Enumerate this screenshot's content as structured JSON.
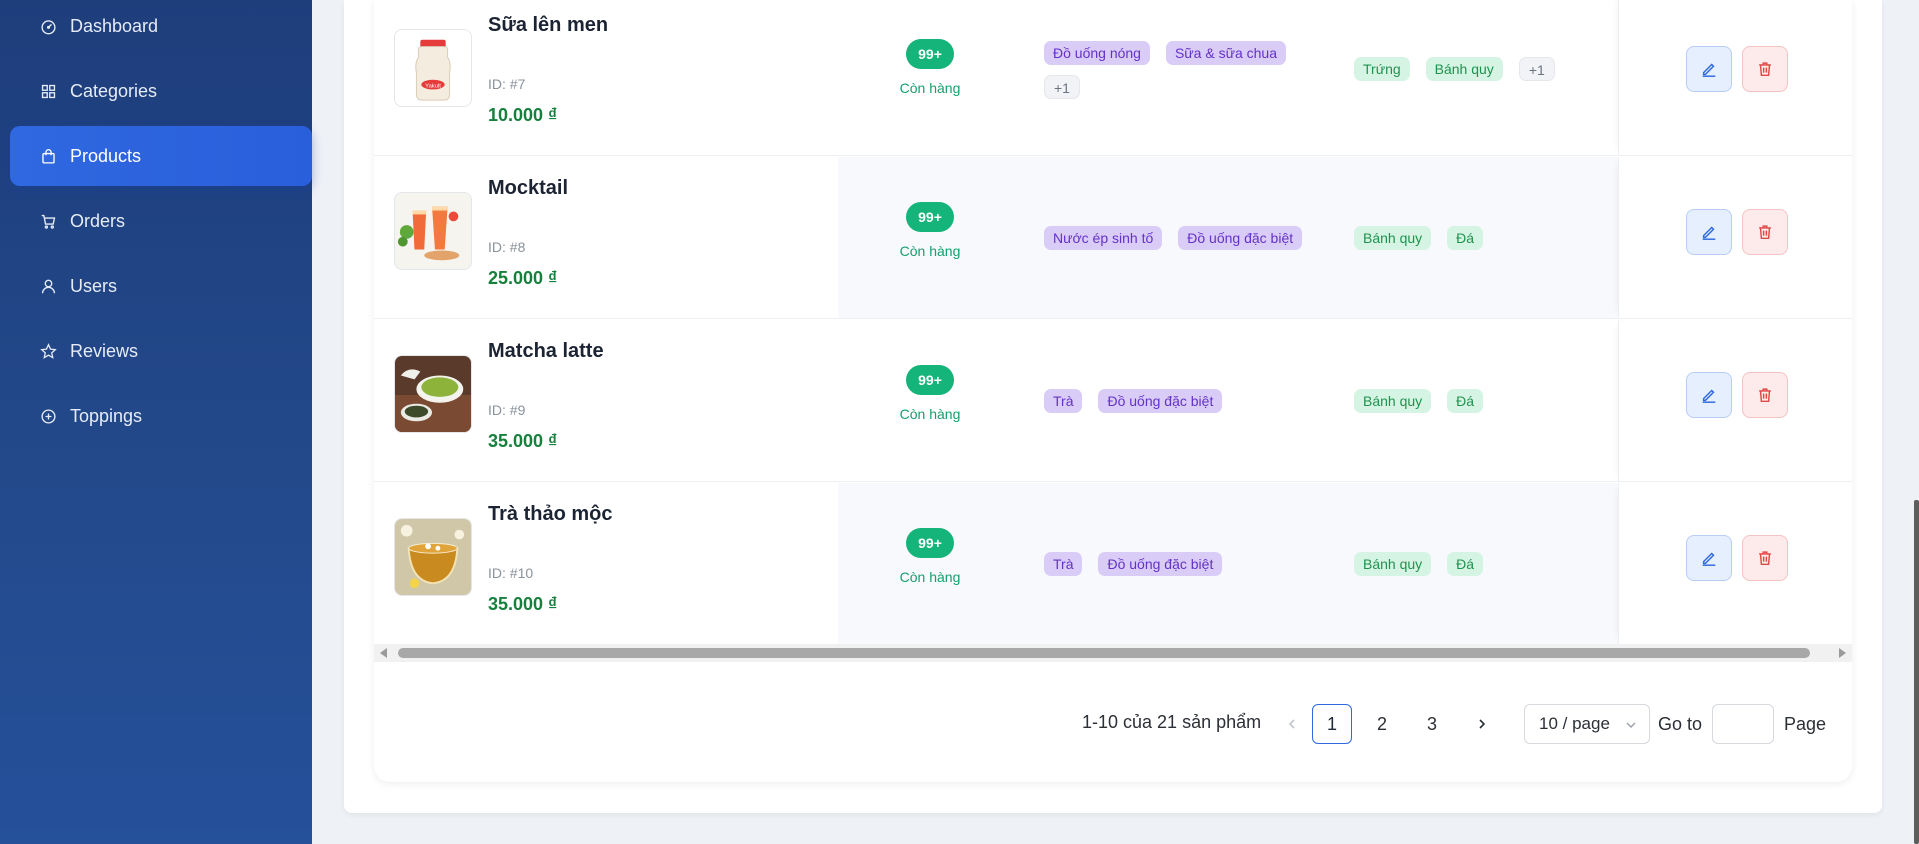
{
  "sidebar": {
    "items": [
      {
        "label": "Dashboard",
        "icon": "dashboard-icon",
        "active": false
      },
      {
        "label": "Categories",
        "icon": "grid-icon",
        "active": false
      },
      {
        "label": "Products",
        "icon": "bag-icon",
        "active": true
      },
      {
        "label": "Orders",
        "icon": "cart-icon",
        "active": false
      },
      {
        "label": "Users",
        "icon": "user-icon",
        "active": false
      },
      {
        "label": "Reviews",
        "icon": "star-icon",
        "active": false
      },
      {
        "label": "Toppings",
        "icon": "plus-circle-icon",
        "active": false
      }
    ]
  },
  "products": [
    {
      "name": "Sữa lên men",
      "id": "ID: #7",
      "price": "10.000 ₫",
      "stock_badge": "99+",
      "stock_text": "Còn hàng",
      "categories": [
        "Đồ uống nóng",
        "Sữa & sữa chua",
        "+1"
      ],
      "toppings": [
        "Trứng",
        "Bánh quy",
        "+1"
      ]
    },
    {
      "name": "Mocktail",
      "id": "ID: #8",
      "price": "25.000 ₫",
      "stock_badge": "99+",
      "stock_text": "Còn hàng",
      "categories": [
        "Nước ép sinh tố",
        "Đồ uống đặc biệt"
      ],
      "toppings": [
        "Bánh quy",
        "Đá"
      ]
    },
    {
      "name": "Matcha latte",
      "id": "ID: #9",
      "price": "35.000 ₫",
      "stock_badge": "99+",
      "stock_text": "Còn hàng",
      "categories": [
        "Trà",
        "Đồ uống đặc biệt"
      ],
      "toppings": [
        "Bánh quy",
        "Đá"
      ]
    },
    {
      "name": "Trà thảo mộc",
      "id": "ID: #10",
      "price": "35.000 ₫",
      "stock_badge": "99+",
      "stock_text": "Còn hàng",
      "categories": [
        "Trà",
        "Đồ uống đặc biệt"
      ],
      "toppings": [
        "Bánh quy",
        "Đá"
      ]
    }
  ],
  "pagination": {
    "total_text": "1-10 của 21 sản phẩm",
    "pages": [
      "1",
      "2",
      "3"
    ],
    "current_page": "1",
    "page_size": "10 / page",
    "goto_label": "Go to",
    "page_label": "Page"
  },
  "colors": {
    "sidebar_bg": "#1e3d7b",
    "active_nav": "#2f68e0",
    "stock_green": "#15b47a",
    "price_green": "#17803d",
    "category_tag": "#d9ccf7",
    "topping_tag": "#d6f4e3"
  }
}
